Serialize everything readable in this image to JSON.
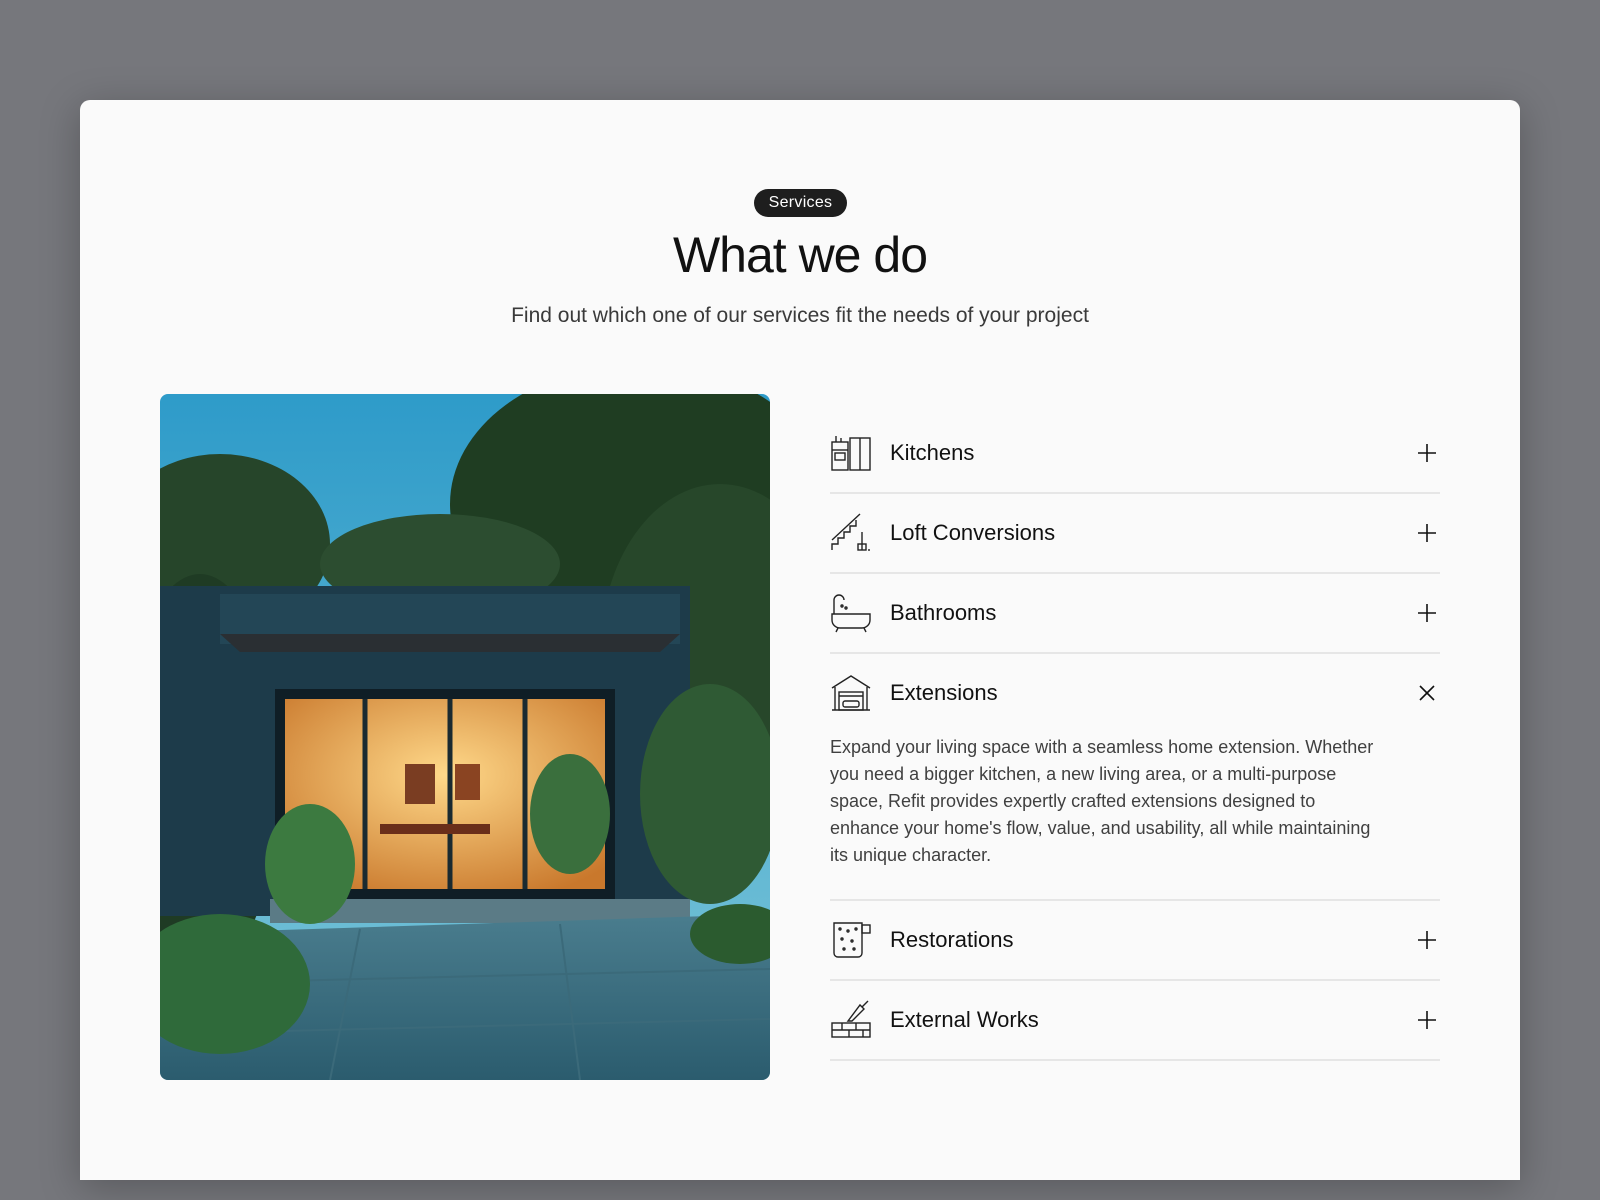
{
  "header": {
    "badge": "Services",
    "title": "What we do",
    "subtitle": "Find out which one of our services fit the needs of your project"
  },
  "services": [
    {
      "label": "Kitchens",
      "icon": "kitchen-icon",
      "expanded": false
    },
    {
      "label": "Loft Conversions",
      "icon": "stairs-icon",
      "expanded": false
    },
    {
      "label": "Bathrooms",
      "icon": "bathtub-icon",
      "expanded": false
    },
    {
      "label": "Extensions",
      "icon": "garage-icon",
      "expanded": true,
      "description": "Expand your living space with a seamless home extension. Whether you need a bigger kitchen, a new living area, or a multi-purpose space, Refit provides expertly crafted extensions designed to enhance your home's flow, value, and usability, all while maintaining its unique character."
    },
    {
      "label": "Restorations",
      "icon": "wallpaper-roll-icon",
      "expanded": false
    },
    {
      "label": "External Works",
      "icon": "brick-trowel-icon",
      "expanded": false
    }
  ],
  "colors": {
    "background": "#76777c",
    "card": "#fafafa",
    "badge": "#1e1e1e",
    "divider": "#e6e6e6"
  }
}
